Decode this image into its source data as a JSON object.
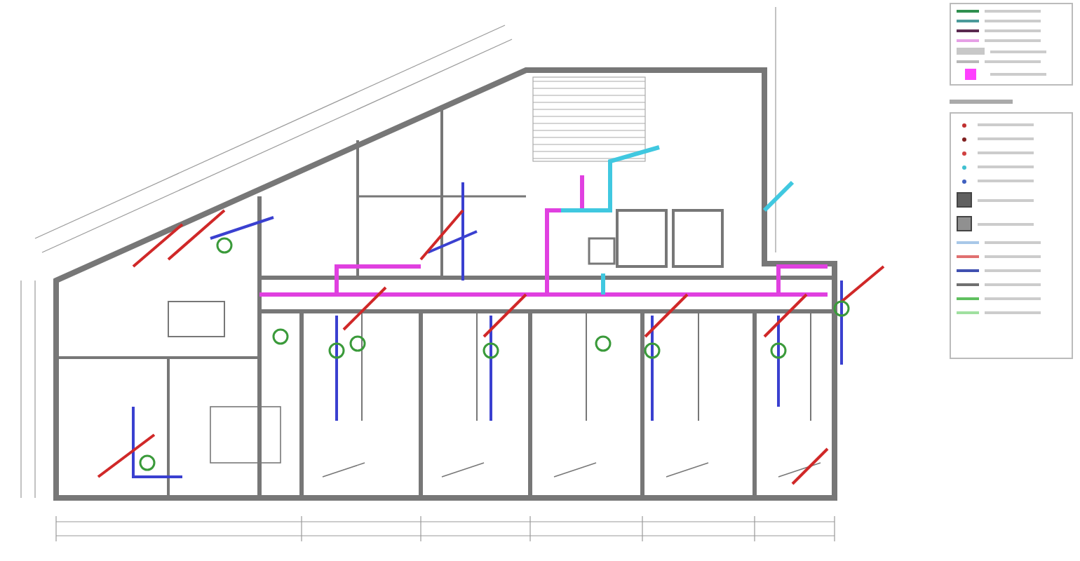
{
  "legend": {
    "items": [
      {
        "kind": "line",
        "color": "#2f8f4f"
      },
      {
        "kind": "line",
        "color": "#4a9a9a"
      },
      {
        "kind": "line",
        "color": "#5a2a50"
      },
      {
        "kind": "line",
        "color": "#e6a0e6"
      },
      {
        "kind": "hatch",
        "color": "#c8c8c8"
      },
      {
        "kind": "line",
        "color": "#b8b8b8"
      },
      {
        "kind": "square",
        "color": "#ff40ff"
      }
    ]
  },
  "symbols_legend": {
    "items": [
      {
        "kind": "dot",
        "color": "#c03030"
      },
      {
        "kind": "dot",
        "color": "#802020"
      },
      {
        "kind": "dot",
        "color": "#d04040"
      },
      {
        "kind": "dot",
        "color": "#40c0d0"
      },
      {
        "kind": "dot",
        "color": "#4060c0"
      },
      {
        "kind": "square",
        "color": "#606060"
      },
      {
        "kind": "square",
        "color": "#909090"
      },
      {
        "kind": "line",
        "color": "#a8c8e8"
      },
      {
        "kind": "line",
        "color": "#e07070"
      },
      {
        "kind": "line",
        "color": "#4050b0"
      },
      {
        "kind": "line",
        "color": "#707070"
      },
      {
        "kind": "line",
        "color": "#60c060"
      },
      {
        "kind": "line",
        "color": "#a0e0a0"
      }
    ]
  }
}
